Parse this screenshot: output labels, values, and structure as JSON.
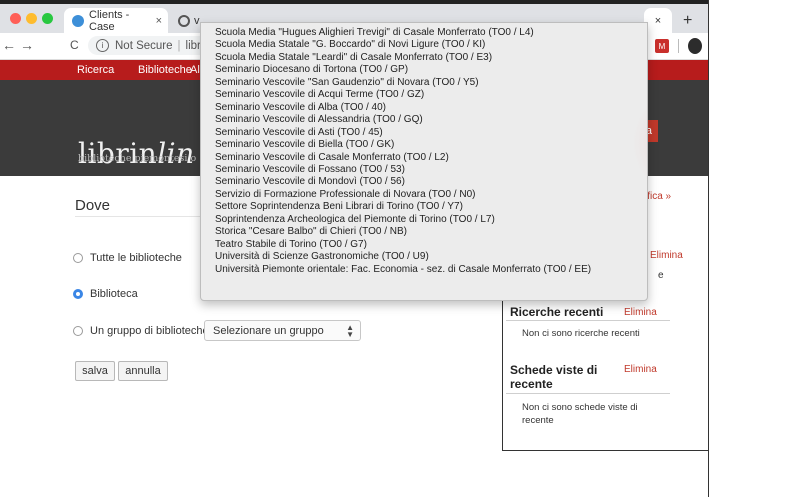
{
  "browser": {
    "tab1_title": "Clients - Case",
    "tab1_close": "×",
    "tab2_title": "v",
    "tab_right_close": "×",
    "new_tab": "+",
    "back": "←",
    "forward": "→",
    "reload": "C",
    "security_label": "Not Secure",
    "url": "librinlinea.it",
    "ext_badge": "M"
  },
  "site": {
    "nav": [
      "Ricerca",
      "Biblioteche",
      "Al"
    ],
    "logo_main": "librin",
    "logo_italic": "lin",
    "tagline": "biblioteche piemontesi o",
    "header_button": "a"
  },
  "form": {
    "section_title": "Dove",
    "option_all": "Tutte le biblioteche",
    "option_library": "Biblioteca",
    "option_group": "Un gruppo di biblioteche",
    "group_select_value": "Selezionare un gruppo",
    "save_label": "salva",
    "cancel_label": "annulla"
  },
  "right_panel": {
    "modify_link": "ifica »",
    "elimina_1": "Elimina",
    "partial_e": "e",
    "recent_searches_title": "Ricerche recenti",
    "elimina_2": "Elimina",
    "recent_searches_empty": "Non ci sono ricerche recenti",
    "recent_cards_title_1": "Schede viste di",
    "recent_cards_title_2": "recente",
    "elimina_3": "Elimina",
    "recent_cards_empty_1": "Non ci sono schede viste di",
    "recent_cards_empty_2": "recente"
  },
  "dropdown": {
    "selected_index": 20,
    "items": [
      "Scuola Media \"Hugues Alighieri Trevigi\" di Casale Monferrato (TO0 / L4)",
      "Scuola Media Statale \"G. Boccardo\" di Novi Ligure (TO0 / KI)",
      "Scuola Media Statale \"Leardi\" di Casale Monferrato (TO0 / E3)",
      "Seminario Diocesano di Tortona (TO0 / GP)",
      "Seminario Vescovile \"San Gaudenzio\" di Novara (TO0 / Y5)",
      "Seminario Vescovile di Acqui Terme (TO0 / GZ)",
      "Seminario Vescovile di Alba (TO0 / 40)",
      "Seminario Vescovile di Alessandria (TO0 / GQ)",
      "Seminario Vescovile di Asti (TO0 / 45)",
      "Seminario Vescovile di Biella (TO0 / GK)",
      "Seminario Vescovile di Casale Monferrato (TO0 / L2)",
      "Seminario Vescovile di Fossano (TO0 / 53)",
      "Seminario Vescovile di Mondovì (TO0 / 56)",
      "Servizio di Formazione Professionale di Novara (TO0 / N0)",
      "Settore Soprintendenza Beni Librari di Torino (TO0 / Y7)",
      "Soprintendenza Archeologica del Piemonte di Torino (TO0 / L7)",
      "Storica \"Cesare Balbo\" di Chieri (TO0 / NB)",
      "Teatro Stabile di Torino (TO0 / G7)",
      "Università di Scienze Gastronomiche (TO0 / U9)",
      "Università Piemonte orientale: Fac. Economia - sez. di Casale Monferrato (TO0 / EE)"
    ]
  },
  "colors": {
    "site_red": "#b71c1c",
    "selection_blue": "#2f6fdc",
    "radio_blue": "#3a86e6"
  }
}
